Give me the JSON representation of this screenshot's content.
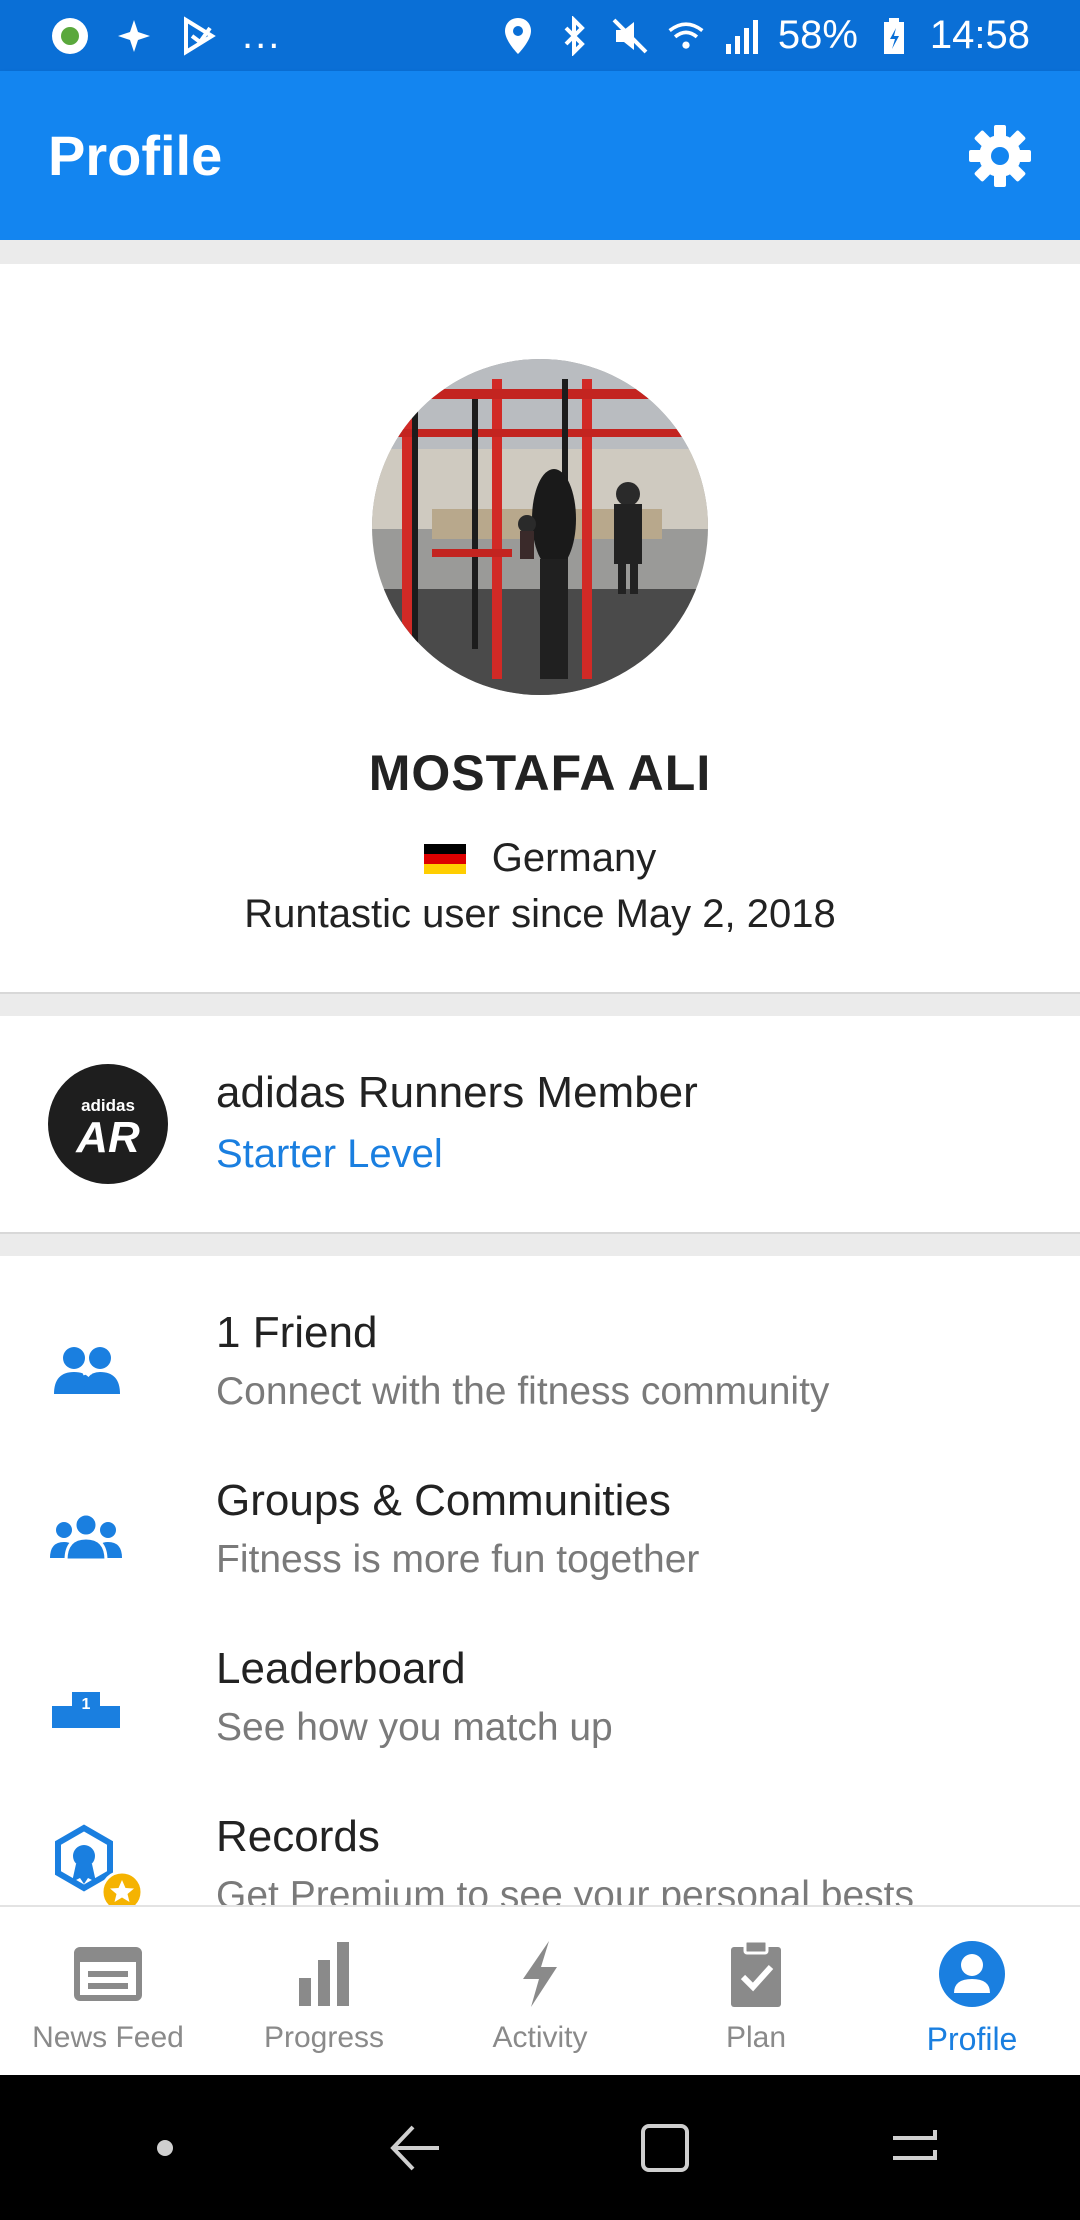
{
  "status_bar": {
    "battery": "58%",
    "time": "14:58",
    "dots": "..."
  },
  "header": {
    "title": "Profile",
    "settings_icon": "gear-icon"
  },
  "profile": {
    "name": "MOSTAFA ALI",
    "country": "Germany",
    "member_since": "Runtastic user since May 2, 2018",
    "flag_colors": [
      "#000000",
      "#dd0000",
      "#ffce00"
    ]
  },
  "adidas_runners": {
    "logo_brand": "adidas",
    "logo_letters": "AR",
    "title": "adidas Runners Member",
    "level": "Starter Level"
  },
  "menu": [
    {
      "icon": "friends-icon",
      "title": "1 Friend",
      "subtitle": "Connect with the fitness community"
    },
    {
      "icon": "groups-icon",
      "title": "Groups & Communities",
      "subtitle": "Fitness is more fun together"
    },
    {
      "icon": "leaderboard-icon",
      "title": "Leaderboard",
      "subtitle": "See how you match up"
    },
    {
      "icon": "records-icon",
      "title": "Records",
      "subtitle": "Get Premium to see your personal bests"
    }
  ],
  "bottom_nav": [
    {
      "label": "News Feed",
      "icon": "news-feed-icon",
      "active": false
    },
    {
      "label": "Progress",
      "icon": "progress-icon",
      "active": false
    },
    {
      "label": "Activity",
      "icon": "activity-icon",
      "active": false
    },
    {
      "label": "Plan",
      "icon": "plan-icon",
      "active": false
    },
    {
      "label": "Profile",
      "icon": "profile-icon",
      "active": true
    }
  ],
  "colors": {
    "primary": "#1385f0",
    "status_bar": "#0a6fd6",
    "accent_text": "#1a7fe0",
    "premium_star": "#f5b301"
  }
}
